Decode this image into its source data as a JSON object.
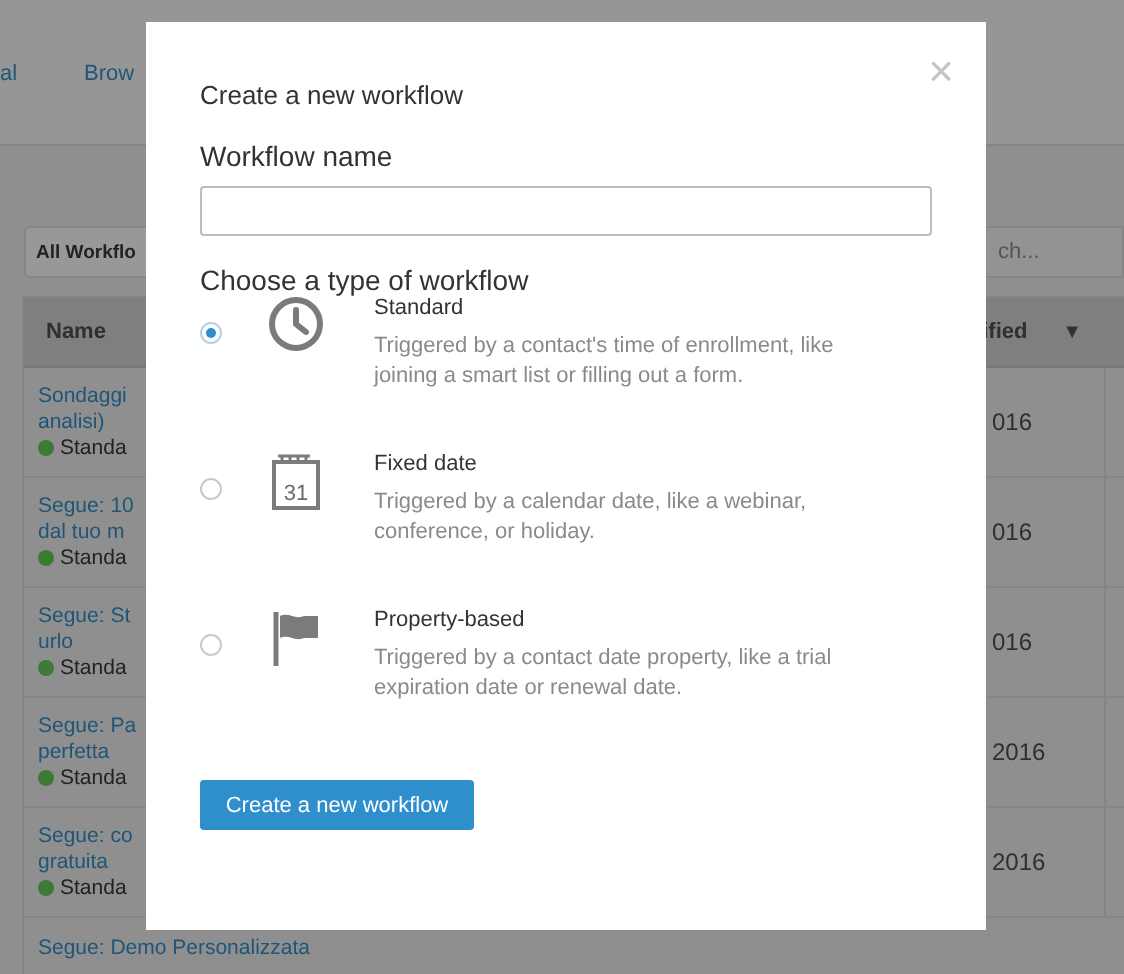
{
  "nav": {
    "tabs": [
      {
        "label": "al"
      },
      {
        "label": "Brow"
      }
    ]
  },
  "toolbar": {
    "filter": "All Workflo",
    "search": {
      "placeholder": "ch..."
    }
  },
  "table": {
    "columns": [
      {
        "label": "Name"
      },
      {
        "label": "ified",
        "sort_icon": "▼"
      }
    ],
    "rows": [
      {
        "name": [
          "Sondaggi",
          "analisi)"
        ],
        "type": "Standa",
        "color": "#3d7a35",
        "date": "016"
      },
      {
        "name": [
          "Segue: 10",
          "dal tuo m"
        ],
        "type": "Standa",
        "color": "#3d7a35",
        "date": "016"
      },
      {
        "name": [
          "Segue: St",
          "urlo"
        ],
        "type": "Standa",
        "color": "#3d7a35",
        "date": "016"
      },
      {
        "name": [
          "Segue: Pa",
          "perfetta"
        ],
        "type": "Standa",
        "color": "#3d7a35",
        "date": "2016"
      },
      {
        "name": [
          "Segue: co",
          "gratuita"
        ],
        "type": "Standa",
        "color": "#3d7a35",
        "date": "2016"
      },
      {
        "name": [
          "Segue: Demo Personalizzata"
        ]
      }
    ]
  },
  "modal": {
    "title": "Create a new workflow",
    "close": "×",
    "name_label": "Workflow name",
    "type_heading": "Choose a type of workflow",
    "options": [
      {
        "kind": "clock",
        "selected": true,
        "title": "Standard",
        "description": "Triggered by a contact's time of enrollment, like joining a smart list or filling out a form."
      },
      {
        "kind": "calendar",
        "icon_label": "31",
        "selected": false,
        "title": "Fixed date",
        "description": "Triggered by a calendar date, like a webinar, conference, or holiday."
      },
      {
        "kind": "flag",
        "selected": false,
        "title": "Property-based",
        "description": "Triggered by a contact date property, like a trial expiration date or renewal date."
      }
    ],
    "button": "Create a new workflow"
  }
}
